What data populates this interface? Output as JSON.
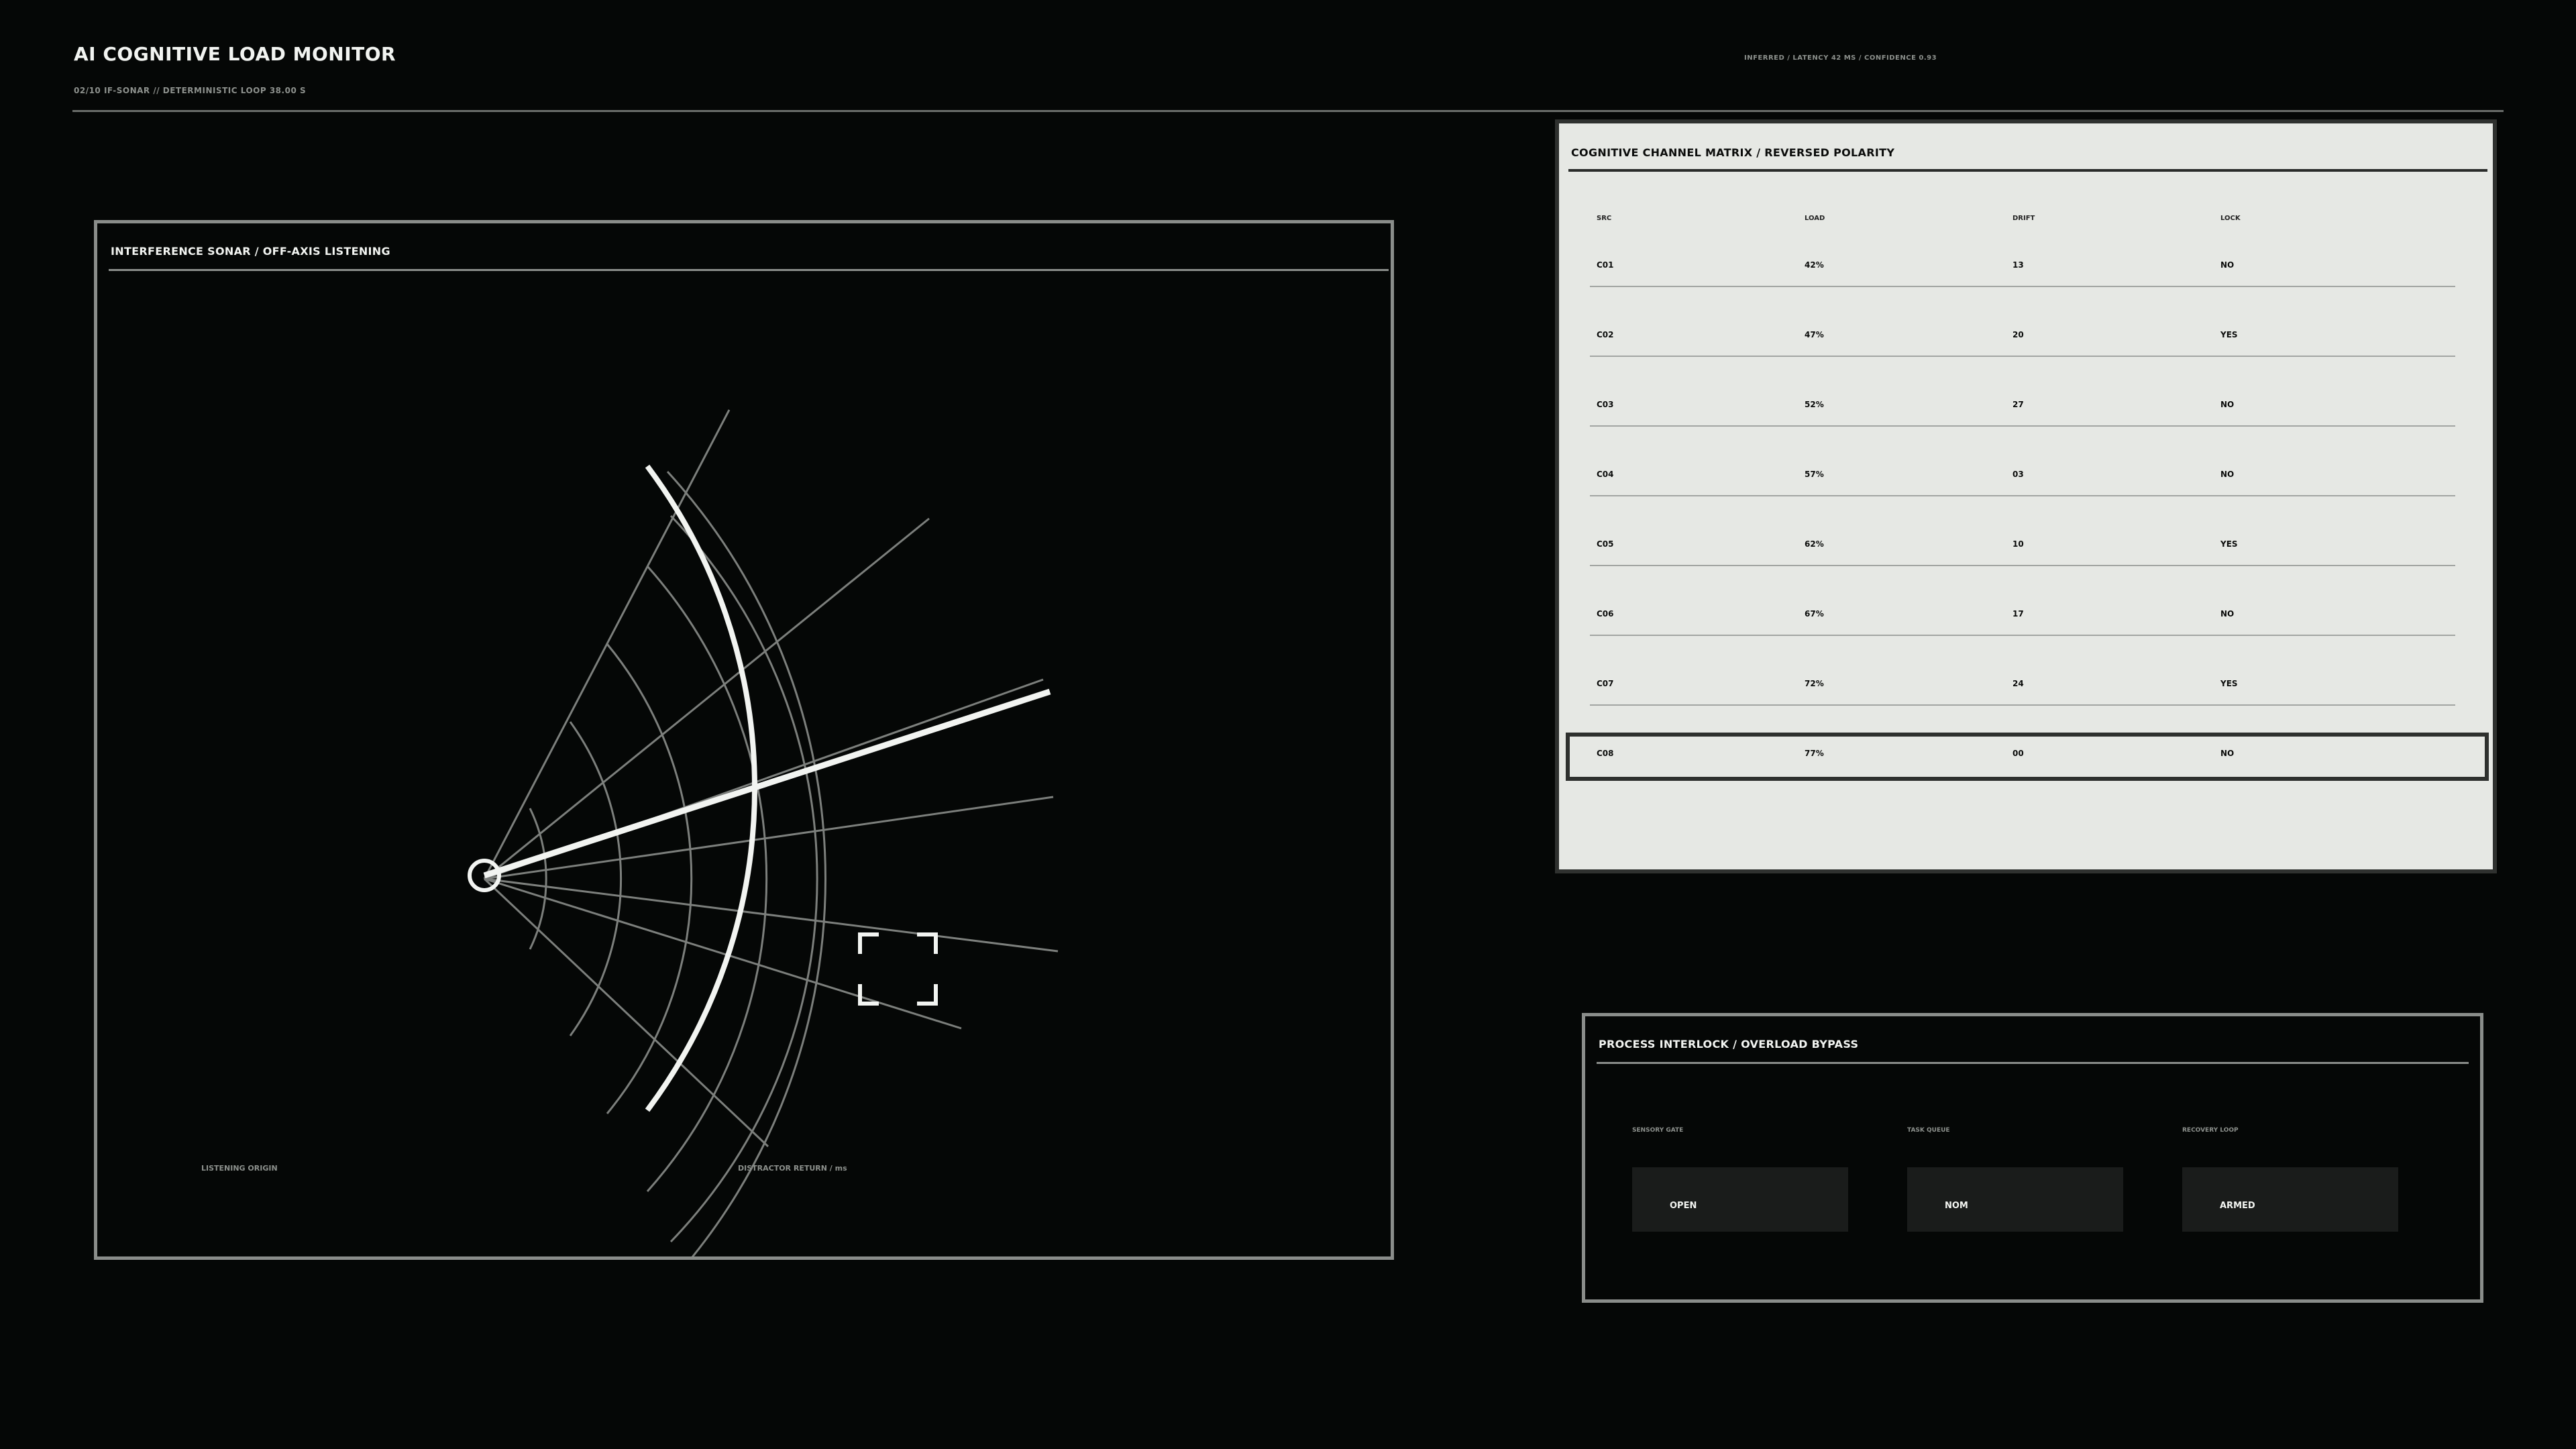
{
  "header": {
    "title": "AI COGNITIVE LOAD MONITOR",
    "subtitle": "02/10 IF-SONAR // DETERMINISTIC LOOP 38.00 S",
    "status": "INFERRED / LATENCY 42 MS / CONFIDENCE 0.93"
  },
  "sonar": {
    "title": "INTERFERENCE SONAR / OFF-AXIS LISTENING",
    "origin_label": "LISTENING ORIGIN",
    "distractor_label": "DISTRACTOR RETURN / ms"
  },
  "matrix": {
    "title": "COGNITIVE CHANNEL MATRIX / REVERSED POLARITY",
    "columns": [
      "SRC",
      "LOAD",
      "DRIFT",
      "LOCK"
    ],
    "rows": [
      [
        "C01",
        "42%",
        "13",
        "NO"
      ],
      [
        "C02",
        "47%",
        "20",
        "YES"
      ],
      [
        "C03",
        "52%",
        "27",
        "NO"
      ],
      [
        "C04",
        "57%",
        "03",
        "NO"
      ],
      [
        "C05",
        "62%",
        "10",
        "YES"
      ],
      [
        "C06",
        "67%",
        "17",
        "NO"
      ],
      [
        "C07",
        "72%",
        "24",
        "YES"
      ],
      [
        "C08",
        "77%",
        "00",
        "NO"
      ]
    ],
    "selected_row": 7
  },
  "interlock": {
    "title": "PROCESS INTERLOCK / OVERLOAD BYPASS",
    "controls": [
      {
        "label": "SENSORY GATE",
        "value": "OPEN"
      },
      {
        "label": "TASK QUEUE",
        "value": "NOM"
      },
      {
        "label": "RECOVERY LOOP",
        "value": "ARMED"
      }
    ]
  },
  "colors": {
    "background": "#050706",
    "panel_light": "#e6e8e4",
    "stroke": "#8a8d8a",
    "accent": "#f2f4f1"
  },
  "icons": {
    "origin": "origin-ring-icon",
    "target": "target-brackets-icon"
  }
}
